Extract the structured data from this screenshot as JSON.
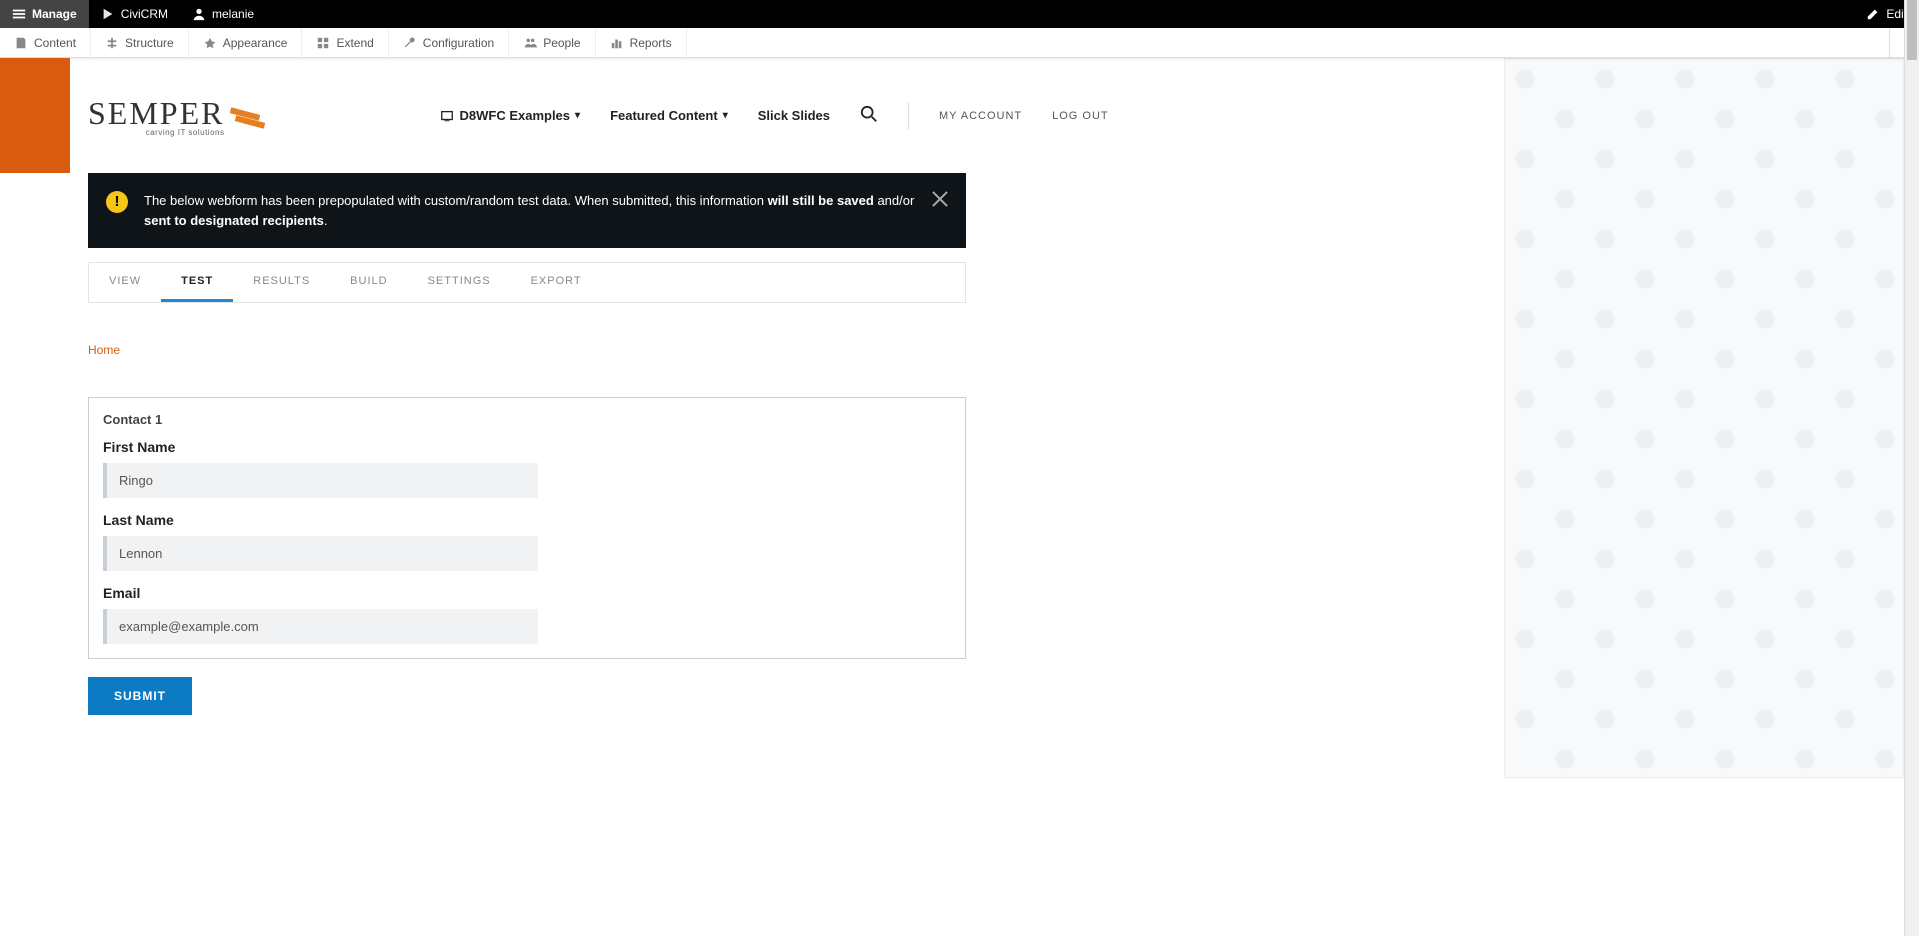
{
  "admin_bar": {
    "manage": "Manage",
    "civicrm": "CiviCRM",
    "user": "melanie",
    "edit": "Edit"
  },
  "toolbar": {
    "items": [
      "Content",
      "Structure",
      "Appearance",
      "Extend",
      "Configuration",
      "People",
      "Reports"
    ]
  },
  "brand": {
    "name": "SEMPER",
    "tagline": "carving IT solutions"
  },
  "nav": {
    "examples": "D8WFC Examples",
    "featured": "Featured Content",
    "slides": "Slick Slides",
    "account": "MY ACCOUNT",
    "logout": "LOG OUT"
  },
  "alert": {
    "pre": "The below webform has been prepopulated with custom/random test data. When submitted, this information ",
    "bold1": "will still be saved",
    "mid": " and/or ",
    "bold2": "sent to designated recipients",
    "post": "."
  },
  "tabs": [
    "VIEW",
    "TEST",
    "RESULTS",
    "BUILD",
    "SETTINGS",
    "EXPORT"
  ],
  "active_tab": "TEST",
  "breadcrumb": {
    "home": "Home"
  },
  "form": {
    "legend": "Contact 1",
    "first_name_label": "First Name",
    "first_name_value": "Ringo",
    "last_name_label": "Last Name",
    "last_name_value": "Lennon",
    "email_label": "Email",
    "email_value": "example@example.com",
    "submit": "SUBMIT"
  }
}
